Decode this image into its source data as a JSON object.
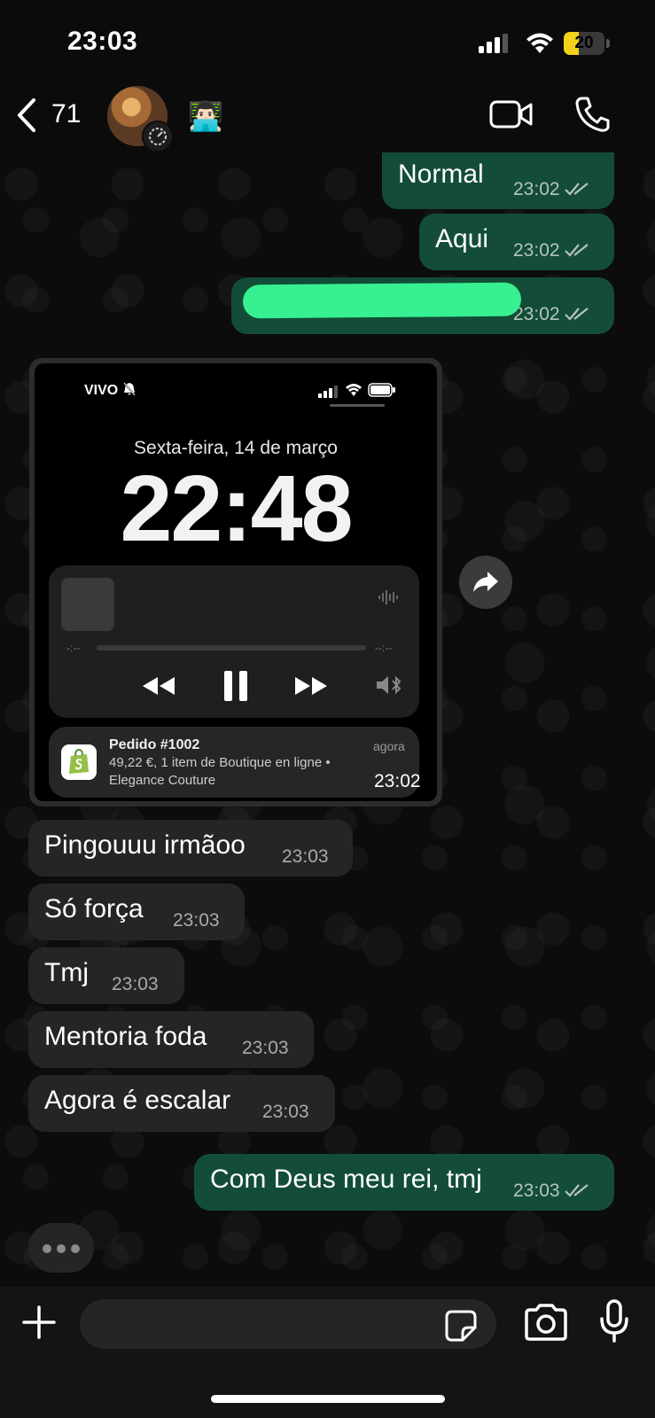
{
  "status_bar": {
    "time": "23:03",
    "battery": "20",
    "battery_level": 0.2
  },
  "header": {
    "back_count": "71",
    "contact_emoji": "👨🏻‍💻"
  },
  "messages": {
    "m1": {
      "text": "Normal",
      "time": "23:02"
    },
    "m2": {
      "text": "Aqui",
      "time": "23:02"
    },
    "m3": {
      "time": "23:02"
    },
    "media": {
      "time": "23:02",
      "carrier": "VIVO",
      "date": "Sexta-feira, 14 de março",
      "clock": "22:48",
      "time_start": "-:--",
      "time_end": "--:--",
      "notification": {
        "title": "Pedido #1002",
        "line1": "49,22 €, 1 item de Boutique en ligne •",
        "line2": "Elegance Couture",
        "when": "agora"
      }
    },
    "m4": {
      "text": "Pingouuu irmãoo",
      "time": "23:03"
    },
    "m5": {
      "text": "Só força",
      "time": "23:03"
    },
    "m6": {
      "text": "Tmj",
      "time": "23:03"
    },
    "m7": {
      "text": "Mentoria foda",
      "time": "23:03"
    },
    "m8": {
      "text": "Agora é escalar",
      "time": "23:03"
    },
    "m9": {
      "text": "Com Deus meu rei, tmj",
      "time": "23:03"
    }
  },
  "colors": {
    "outgoing": "#134d37",
    "incoming": "#242626",
    "redaction": "#36f091"
  },
  "icons": [
    "chevron-left-icon",
    "video-icon",
    "phone-icon",
    "share-icon",
    "plus-icon",
    "sticker-icon",
    "camera-icon",
    "mic-icon"
  ]
}
